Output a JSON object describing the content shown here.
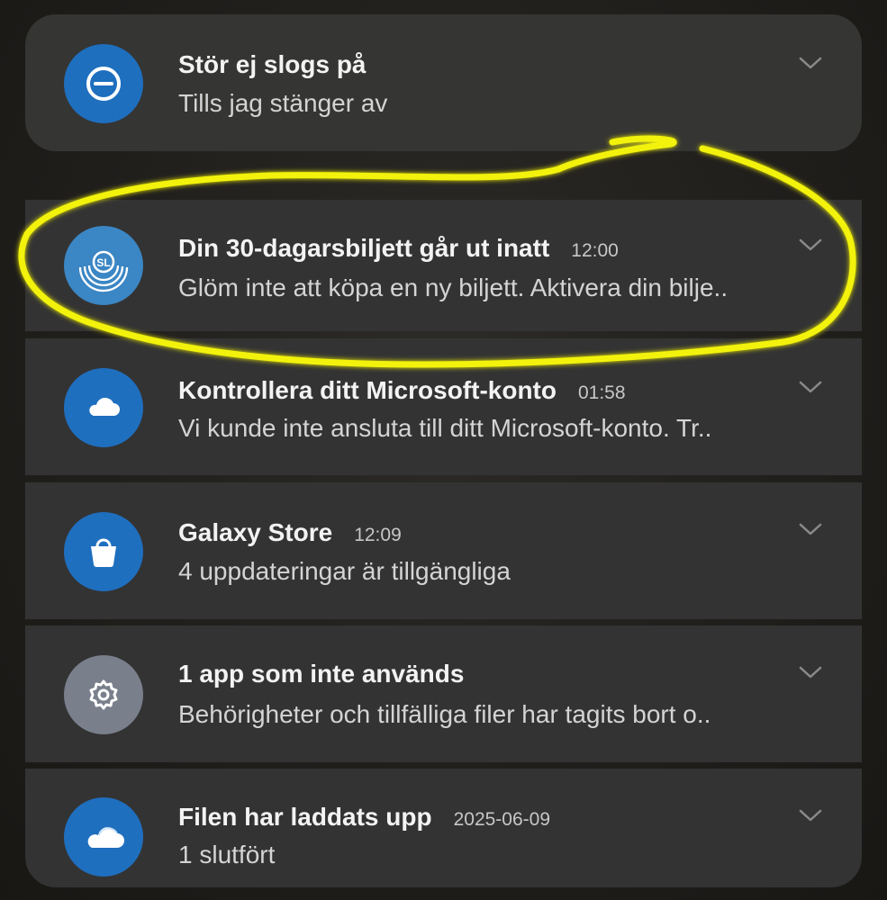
{
  "colors": {
    "panel": "#333333",
    "icon_blue": "#1f6fbf",
    "icon_sl": "#3b86c4",
    "icon_gray": "#7a7f8c",
    "highlight": "#f2f20a"
  },
  "notifications": [
    {
      "title": "Stör ej slogs på",
      "time": "",
      "text": "Tills jag stänger av",
      "icon": "do-not-disturb-icon"
    },
    {
      "title": "Din 30-dagarsbiljett går ut inatt",
      "time": "12:00",
      "text": "Glöm inte att köpa en ny biljett. Aktivera din bilje..",
      "icon": "sl-logo-icon",
      "icon_text": "SL"
    },
    {
      "title": "Kontrollera ditt Microsoft-konto",
      "time": "01:58",
      "text": "Vi kunde inte ansluta till ditt Microsoft-konto. Tr..",
      "icon": "cloud-icon"
    },
    {
      "title": "Galaxy Store",
      "time": "12:09",
      "text": "4 uppdateringar är tillgängliga",
      "icon": "shopping-bag-icon"
    },
    {
      "title": "1 app som inte används",
      "time": "",
      "text": "Behörigheter och tillfälliga filer har tagits bort o..",
      "icon": "gear-icon"
    },
    {
      "title": "Filen har laddats upp",
      "time": "2025-06-09",
      "text": "1 slutfört",
      "icon": "onedrive-cloud-icon"
    }
  ]
}
